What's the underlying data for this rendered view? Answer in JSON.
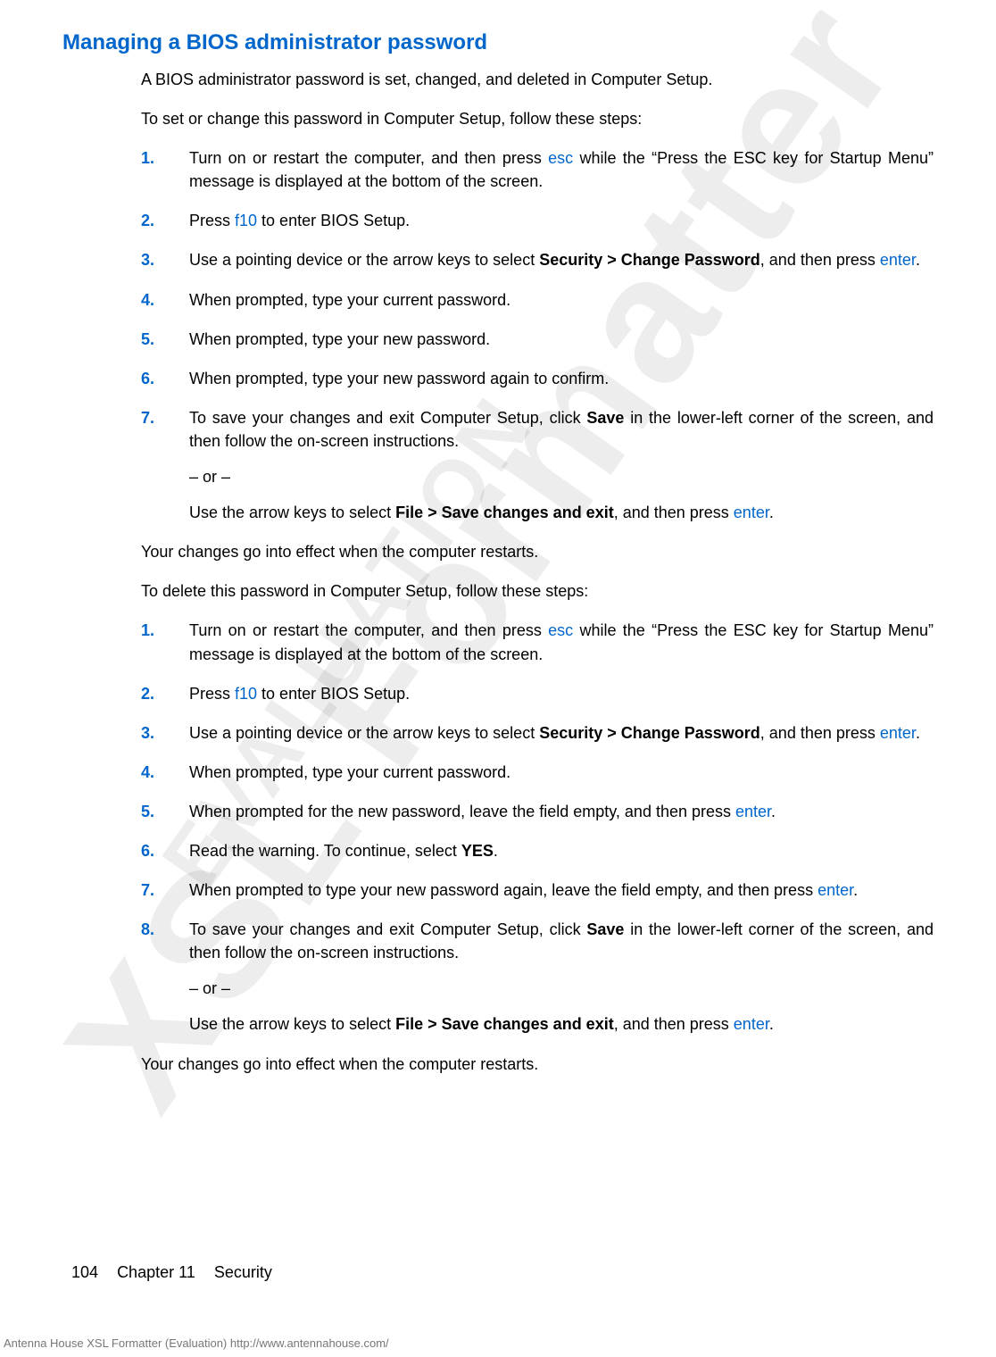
{
  "watermarks": {
    "large": "XSL Formatter",
    "small": "EVALUATION"
  },
  "heading": "Managing a BIOS administrator password",
  "intro1": "A BIOS administrator password is set, changed, and deleted in Computer Setup.",
  "intro2": "To set or change this password in Computer Setup, follow these steps:",
  "set_steps": [
    {
      "num": "1.",
      "pre": "Turn on or restart the computer, and then press ",
      "key": "esc",
      "post": " while the “Press the ESC key for Startup Menu” message is displayed at the bottom of the screen."
    },
    {
      "num": "2.",
      "pre": "Press ",
      "key": "f10",
      "post": " to enter BIOS Setup."
    },
    {
      "num": "3.",
      "pre": "Use a pointing device or the arrow keys to select ",
      "bold1": "Security > Change Password",
      "mid": ", and then press ",
      "key2": "enter",
      "post2": "."
    },
    {
      "num": "4.",
      "plain": "When prompted, type your current password."
    },
    {
      "num": "5.",
      "plain": "When prompted, type your new password."
    },
    {
      "num": "6.",
      "plain": "When prompted, type your new password again to confirm."
    },
    {
      "num": "7.",
      "pre": "To save your changes and exit Computer Setup, click ",
      "bold1": "Save",
      "post": " in the lower-left corner of the screen, and then follow the on-screen instructions.",
      "sub_or": "– or –",
      "sub_pre": "Use the arrow keys to select ",
      "sub_bold": "File > Save changes and exit",
      "sub_mid": ", and then press ",
      "sub_key": "enter",
      "sub_post": "."
    }
  ],
  "after_set": "Your changes go into effect when the computer restarts.",
  "delete_intro": "To delete this password in Computer Setup, follow these steps:",
  "delete_steps": [
    {
      "num": "1.",
      "pre": "Turn on or restart the computer, and then press ",
      "key": "esc",
      "post": " while the “Press the ESC key for Startup Menu” message is displayed at the bottom of the screen."
    },
    {
      "num": "2.",
      "pre": "Press ",
      "key": "f10",
      "post": " to enter BIOS Setup."
    },
    {
      "num": "3.",
      "pre": "Use a pointing device or the arrow keys to select ",
      "bold1": "Security > Change Password",
      "mid": ", and then press ",
      "key2": "enter",
      "post2": "."
    },
    {
      "num": "4.",
      "plain": "When prompted, type your current password."
    },
    {
      "num": "5.",
      "pre": "When prompted for the new password, leave the field empty, and then press ",
      "key": "enter",
      "post": "."
    },
    {
      "num": "6.",
      "pre": "Read the warning. To continue, select ",
      "bold1": "YES",
      "post": "."
    },
    {
      "num": "7.",
      "pre": "When prompted to type your new password again, leave the field empty, and then press ",
      "key": "enter",
      "post": "."
    },
    {
      "num": "8.",
      "pre": "To save your changes and exit Computer Setup, click ",
      "bold1": "Save",
      "post": " in the lower-left corner of the screen, and then follow the on-screen instructions.",
      "sub_or": "– or –",
      "sub_pre": "Use the arrow keys to select ",
      "sub_bold": "File > Save changes and exit",
      "sub_mid": ", and then press ",
      "sub_key": "enter",
      "sub_post": "."
    }
  ],
  "after_delete": "Your changes go into effect when the computer restarts.",
  "footer": {
    "page": "104",
    "chapter": "Chapter 11",
    "title": "Security"
  },
  "eval_footer": "Antenna House XSL Formatter (Evaluation)  http://www.antennahouse.com/"
}
